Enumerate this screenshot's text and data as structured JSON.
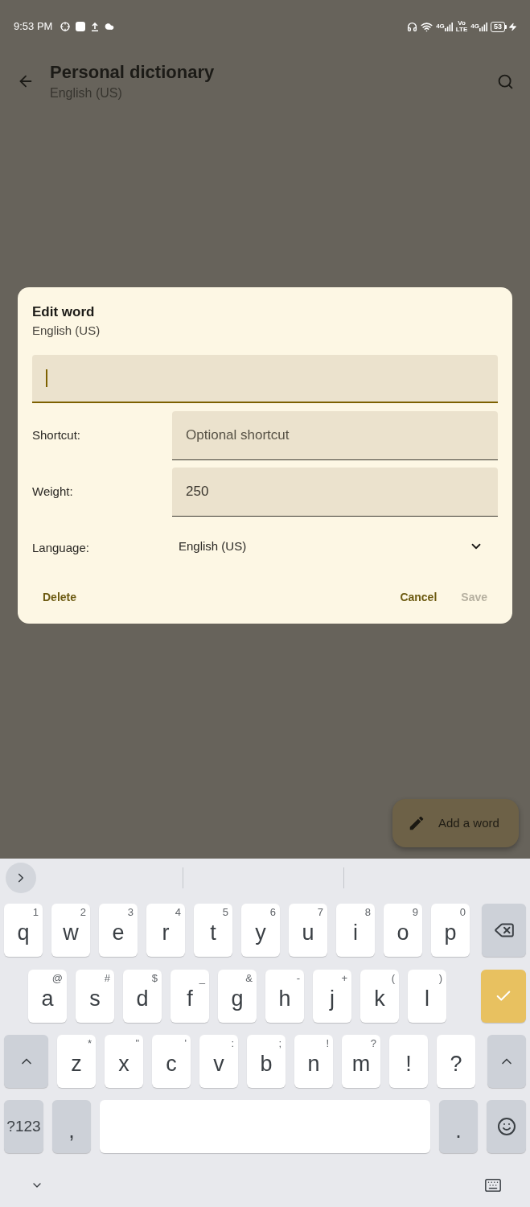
{
  "status_bar": {
    "time": "9:53 PM",
    "indicators": [
      {
        "kind": "headphones"
      },
      {
        "kind": "wifi"
      },
      {
        "kind": "signal",
        "label": "4G"
      },
      {
        "kind": "volte",
        "lines": [
          "Vo",
          "LTE"
        ]
      },
      {
        "kind": "signal",
        "label": "4G"
      },
      {
        "kind": "battery",
        "label": "53",
        "charging": true
      }
    ]
  },
  "app_bar": {
    "title": "Personal dictionary",
    "subtitle": "English (US)"
  },
  "dialog": {
    "title": "Edit word",
    "subtitle": "English (US)",
    "word_field": {
      "focused": true
    },
    "fields": [
      {
        "label": "Shortcut:",
        "placeholder": "Optional shortcut"
      },
      {
        "label": "Weight:",
        "value": "250"
      }
    ],
    "language": {
      "label": "Language:",
      "value": "English (US)"
    },
    "buttons": [
      {
        "label": "Delete",
        "disabled": false
      },
      {
        "label": "Cancel",
        "disabled": false
      },
      {
        "label": "Save",
        "disabled": true
      }
    ]
  },
  "fab": {
    "label": "Add a word"
  },
  "keyboard": {
    "rows": [
      {
        "keys": [
          {
            "kind": "letter",
            "label": "q",
            "hint": "1"
          },
          {
            "kind": "letter",
            "label": "w",
            "hint": "2"
          },
          {
            "kind": "letter",
            "label": "e",
            "hint": "3"
          },
          {
            "kind": "letter",
            "label": "r",
            "hint": "4"
          },
          {
            "kind": "letter",
            "label": "t",
            "hint": "5"
          },
          {
            "kind": "letter",
            "label": "y",
            "hint": "6"
          },
          {
            "kind": "letter",
            "label": "u",
            "hint": "7"
          },
          {
            "kind": "letter",
            "label": "i",
            "hint": "8"
          },
          {
            "kind": "letter",
            "label": "o",
            "hint": "9"
          },
          {
            "kind": "letter",
            "label": "p",
            "hint": "0"
          },
          {
            "kind": "backspace"
          }
        ]
      },
      {
        "keys": [
          {
            "kind": "letter",
            "label": "a",
            "hint": "@"
          },
          {
            "kind": "letter",
            "label": "s",
            "hint": "#"
          },
          {
            "kind": "letter",
            "label": "d",
            "hint": "$"
          },
          {
            "kind": "letter",
            "label": "f",
            "hint": "_"
          },
          {
            "kind": "letter",
            "label": "g",
            "hint": "&"
          },
          {
            "kind": "letter",
            "label": "h",
            "hint": "-"
          },
          {
            "kind": "letter",
            "label": "j",
            "hint": "+"
          },
          {
            "kind": "letter",
            "label": "k",
            "hint": "("
          },
          {
            "kind": "letter",
            "label": "l",
            "hint": ")"
          },
          {
            "kind": "enter"
          }
        ]
      },
      {
        "keys": [
          {
            "kind": "shift"
          },
          {
            "kind": "letter",
            "label": "z",
            "hint": "*"
          },
          {
            "kind": "letter",
            "label": "x",
            "hint": "\""
          },
          {
            "kind": "letter",
            "label": "c",
            "hint": "'"
          },
          {
            "kind": "letter",
            "label": "v",
            "hint": ":"
          },
          {
            "kind": "letter",
            "label": "b",
            "hint": ";"
          },
          {
            "kind": "letter",
            "label": "n",
            "hint": "!"
          },
          {
            "kind": "letter",
            "label": "m",
            "hint": "?"
          },
          {
            "kind": "letter",
            "label": "!"
          },
          {
            "kind": "letter",
            "label": "?"
          },
          {
            "kind": "shift"
          }
        ]
      },
      {
        "keys": [
          {
            "kind": "symbols",
            "label": "?123"
          },
          {
            "kind": "function",
            "label": ","
          },
          {
            "kind": "space"
          },
          {
            "kind": "function",
            "label": "."
          },
          {
            "kind": "emoji"
          }
        ]
      }
    ]
  }
}
